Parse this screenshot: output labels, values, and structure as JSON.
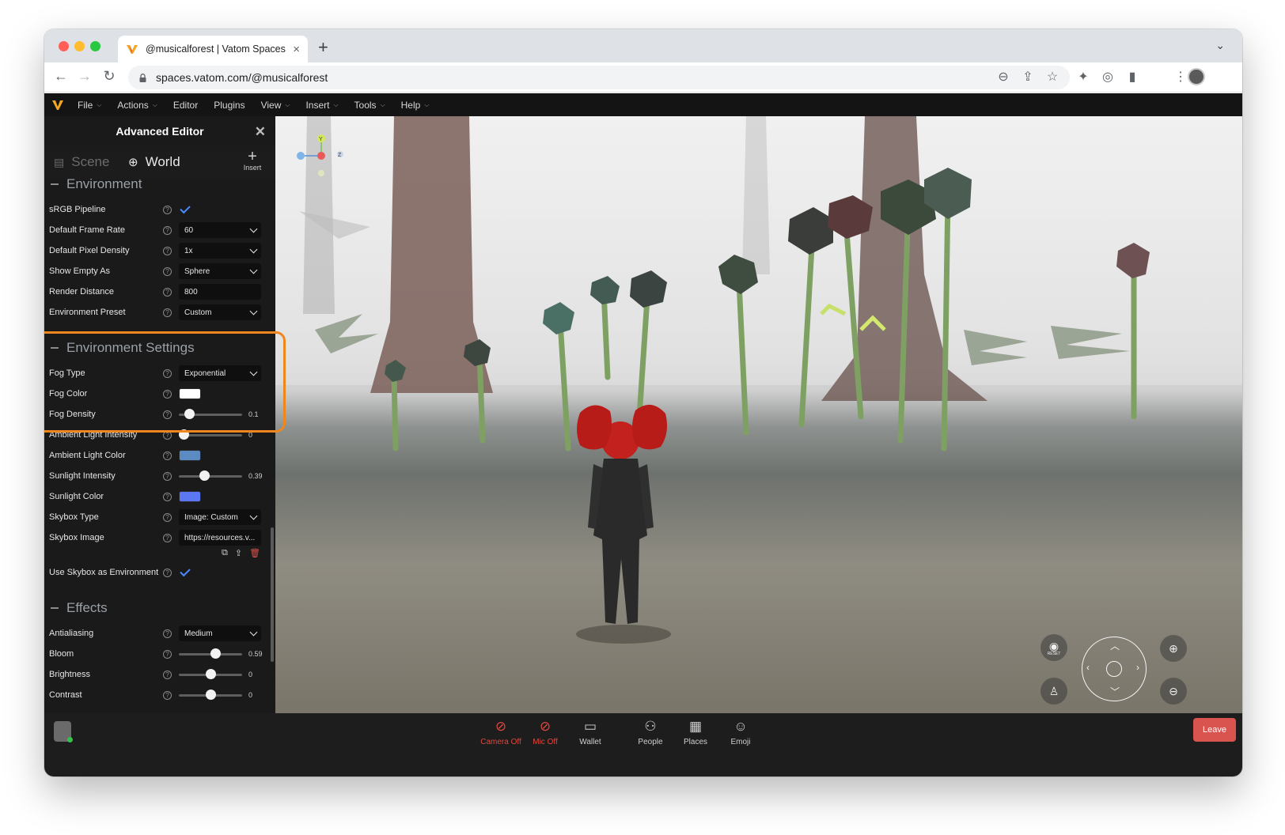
{
  "browser": {
    "tab_title": "@musicalforest | Vatom Spaces",
    "new_tab_label": "+",
    "url": "spaces.vatom.com/@musicalforest"
  },
  "menubar": {
    "items": [
      {
        "label": "File",
        "has_caret": true
      },
      {
        "label": "Actions",
        "has_caret": true
      },
      {
        "label": "Editor",
        "has_caret": false
      },
      {
        "label": "Plugins",
        "has_caret": false
      },
      {
        "label": "View",
        "has_caret": true
      },
      {
        "label": "Insert",
        "has_caret": true
      },
      {
        "label": "Tools",
        "has_caret": true
      },
      {
        "label": "Help",
        "has_caret": true
      }
    ]
  },
  "panel": {
    "title": "Advanced Editor",
    "tabs": {
      "scene": "Scene",
      "world": "World",
      "active": "World"
    },
    "insert_label": "Insert",
    "sections": {
      "environment": "Environment",
      "environment_settings": "Environment Settings",
      "effects": "Effects"
    },
    "rows": {
      "srgb": {
        "label": "sRGB Pipeline",
        "checked": true
      },
      "frame_rate": {
        "label": "Default Frame Rate",
        "value": "60"
      },
      "pixel_density": {
        "label": "Default Pixel Density",
        "value": "1x"
      },
      "show_empty": {
        "label": "Show Empty As",
        "value": "Sphere"
      },
      "render_distance": {
        "label": "Render Distance",
        "value": "800"
      },
      "env_preset": {
        "label": "Environment Preset",
        "value": "Custom"
      },
      "fog_type": {
        "label": "Fog Type",
        "value": "Exponential"
      },
      "fog_color": {
        "label": "Fog Color",
        "color": "#ffffff"
      },
      "fog_density": {
        "label": "Fog Density",
        "value": "0.1",
        "fraction": 0.1
      },
      "ambient_intensity": {
        "label": "Ambient Light Intensity",
        "value": "0",
        "fraction": 0.0
      },
      "ambient_color": {
        "label": "Ambient Light Color",
        "color": "#5b8bc2"
      },
      "sunlight_intensity": {
        "label": "Sunlight Intensity",
        "value": "0.39",
        "fraction": 0.39
      },
      "sunlight_color": {
        "label": "Sunlight Color",
        "color": "#5b78f2"
      },
      "skybox_type": {
        "label": "Skybox Type",
        "value": "Image: Custom"
      },
      "skybox_image": {
        "label": "Skybox Image",
        "value": "https://resources.v..."
      },
      "use_skybox_env": {
        "label": "Use Skybox as Environment",
        "checked": true
      },
      "antialiasing": {
        "label": "Antialiasing",
        "value": "Medium"
      },
      "bloom": {
        "label": "Bloom",
        "value": "0.59",
        "fraction": 0.59
      },
      "brightness": {
        "label": "Brightness",
        "value": "0",
        "fraction": 0.5
      },
      "contrast": {
        "label": "Contrast",
        "value": "0",
        "fraction": 0.5
      }
    }
  },
  "gizmo": {
    "y": "Y",
    "z": "Z"
  },
  "scene_controls": {
    "reset_label": "RESET"
  },
  "bottom_bar": {
    "items": [
      {
        "label": "Camera Off",
        "icon": "camera-off-icon",
        "color": "#e0483e"
      },
      {
        "label": "Mic Off",
        "icon": "mic-off-icon",
        "color": "#e0483e"
      },
      {
        "label": "Wallet",
        "icon": "wallet-icon",
        "color": "#cfcfcf"
      },
      {
        "label": "People",
        "icon": "people-icon",
        "color": "#cfcfcf"
      },
      {
        "label": "Places",
        "icon": "places-icon",
        "color": "#cfcfcf"
      },
      {
        "label": "Emoji",
        "icon": "emoji-icon",
        "color": "#cfcfcf"
      }
    ],
    "leave_label": "Leave"
  },
  "colors": {
    "accent_highlight": "#f0861e",
    "leave": "#d9534f",
    "check": "#4a8cff"
  }
}
